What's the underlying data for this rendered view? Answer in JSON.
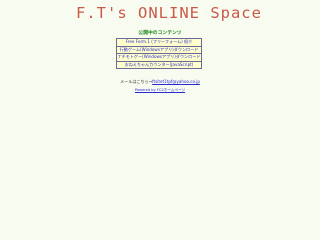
{
  "site": {
    "title": "F.T's ONLINE Space"
  },
  "contents": {
    "heading": "公開中のコンテンツ",
    "items": [
      {
        "label": "Free Form.1 (フリーフォーム) 紹介"
      },
      {
        "label": "行動ゲーム(Windowsアプリ)ダウンロード"
      },
      {
        "label": "ナチモトゲー(Windowsアプリ)ダウンロード"
      },
      {
        "label": "おねえちゃんカウンター(JavaScript)"
      }
    ]
  },
  "mail": {
    "prefix": "メールはこちら→",
    "address": "ftsitet1tpf@yahoo.co.jp"
  },
  "ad": {
    "link": "Powered by FC2ホームページ"
  }
}
